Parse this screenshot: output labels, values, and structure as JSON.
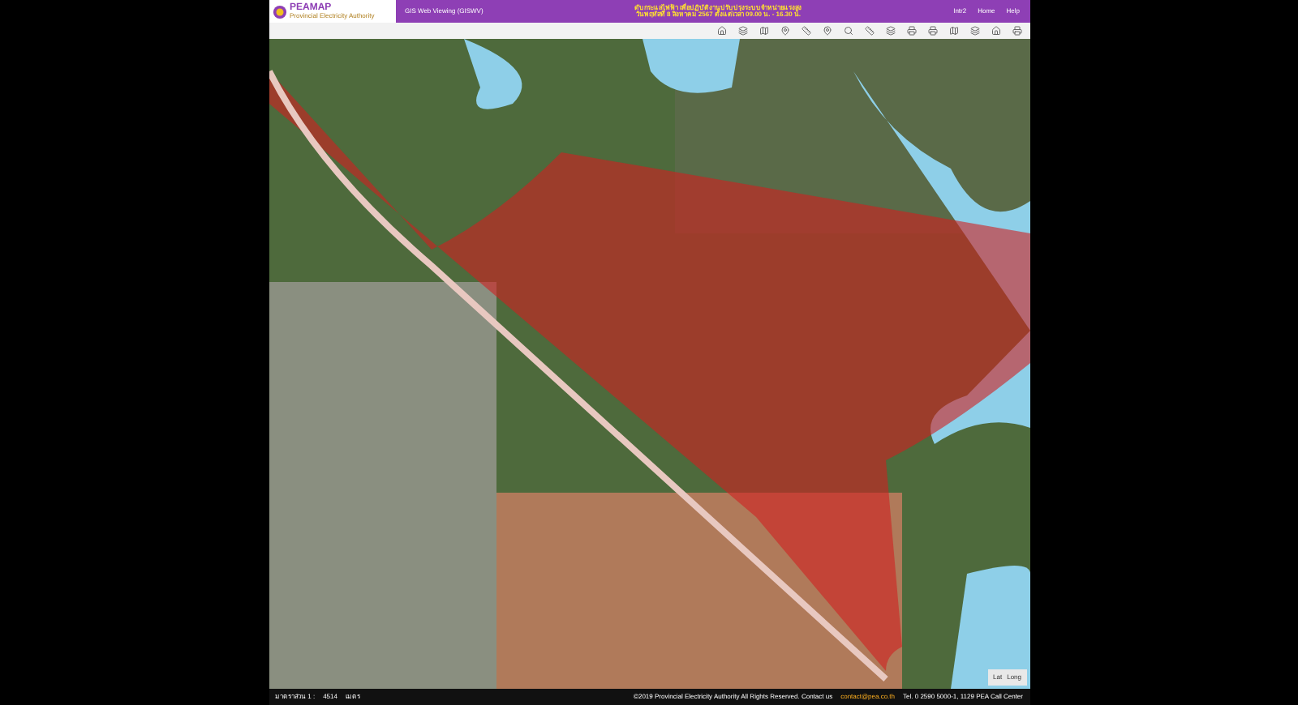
{
  "header": {
    "logo_title": "PEAMAP",
    "logo_subtitle": "Provincial Electricity Authority",
    "app_title": "GIS Web Viewing (GISWV)",
    "notice_lines": [
      "ดับกระแสไฟฟ้า เพื่อปฏิบัติงานปรับปรุงระบบจำหน่ายแรงสูง",
      "วันพฤหัสที่ 8 สิงหาคม 2567 ตั้งแต่เวลา 09.00 น. - 16.30 น."
    ],
    "links": [
      "Intr2",
      "Home",
      "Help"
    ]
  },
  "toolbar": {
    "tools": [
      {
        "kind": "home"
      },
      {
        "kind": "layers"
      },
      {
        "kind": "map"
      },
      {
        "kind": "pin"
      },
      {
        "kind": "ruler"
      },
      {
        "kind": "pin"
      },
      {
        "kind": "search"
      },
      {
        "kind": "ruler"
      },
      {
        "kind": "layers"
      },
      {
        "kind": "print"
      },
      {
        "kind": "print"
      },
      {
        "kind": "map"
      },
      {
        "kind": "layers"
      },
      {
        "kind": "home"
      },
      {
        "kind": "print"
      }
    ]
  },
  "coords": {
    "lat_label": "Lat",
    "long_label": "Long"
  },
  "status_bar": {
    "scale_label": "มาตราส่วน 1 :",
    "scale_value": "4514",
    "unit": "เมตร",
    "copyright": "©2019 Provincial Electricity Authority All Rights Reserved. Contact us",
    "contact": "contact@pea.co.th",
    "phone": "Tel. 0 2590 5000-1, 1129 PEA Call Center"
  }
}
